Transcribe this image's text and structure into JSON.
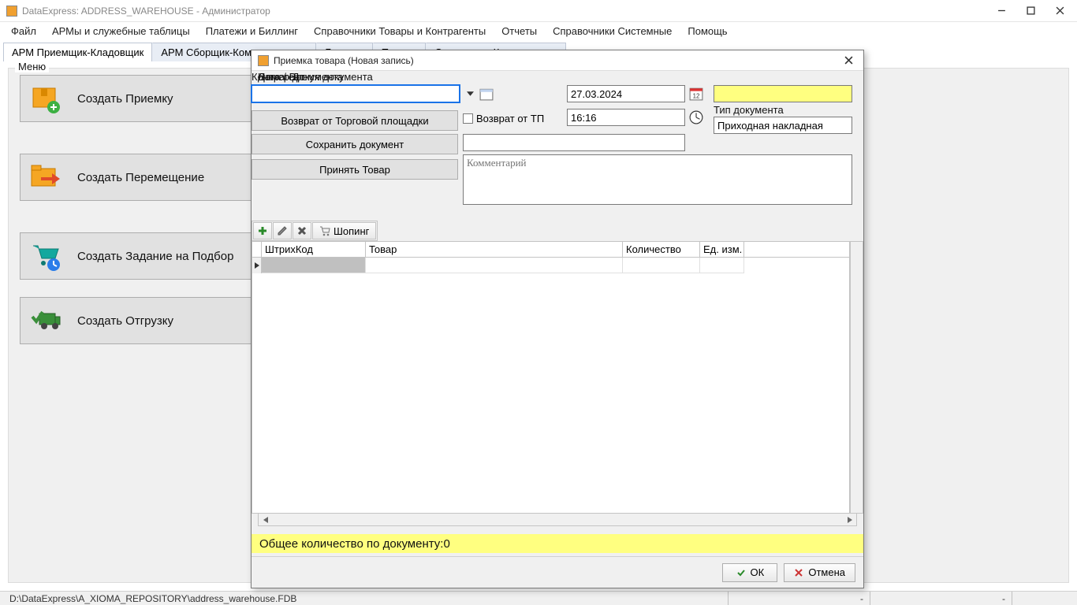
{
  "window": {
    "title": "DataExpress: ADDRESS_WAREHOUSE - Администратор"
  },
  "menubar": {
    "items": [
      "Файл",
      "АРМы и служебные таблицы",
      "Платежи и Биллинг",
      "Справочники Товары и Контрагенты",
      "Отчеты",
      "Справочники Системные",
      "Помощь"
    ]
  },
  "tabs": {
    "items": [
      "АРМ Приемщик-Кладовщик",
      "АРМ Сборщик-Комплектовщик",
      "Биллинг",
      "Товары",
      "Отчеты для Контрагентов"
    ],
    "active_index": 0
  },
  "sidebar": {
    "group_label": "Меню",
    "buttons": [
      {
        "label": "Создать Приемку"
      },
      {
        "label": "Создать Перемещение"
      },
      {
        "label": "Создать Задание на Подбор"
      },
      {
        "label": "Создать Отгрузку"
      }
    ]
  },
  "dialog": {
    "title": "Приемка товара (Новая запись)",
    "labels": {
      "contractor": "Контрагент",
      "date_doc": "Дата / Время документа",
      "doc_no": "Номер Документа",
      "doc_type": "Тип документа",
      "return_tp": "Возврат от ТП"
    },
    "fields": {
      "contractor": "",
      "date": "27.03.2024",
      "time": "16:16",
      "doc_no": "",
      "doc_type": "Приходная накладная",
      "extra": "",
      "comment_placeholder": "Комментарий"
    },
    "buttons": {
      "return_platform": "Возврат от Торговой площадки",
      "save_doc": "Сохранить документ",
      "accept_goods": "Принять Товар",
      "shopping": "Шопинг"
    },
    "grid": {
      "columns": [
        "ШтрихКод",
        "Товар",
        "Количество",
        "Ед. изм."
      ]
    },
    "summary": {
      "label": "Общее количество по документу: ",
      "value": "0"
    },
    "footer": {
      "ok": "ОК",
      "cancel": "Отмена"
    }
  },
  "statusbar": {
    "path": "D:\\DataExpress\\A_XIOMA_REPOSITORY\\address_warehouse.FDB",
    "dash": "-"
  }
}
